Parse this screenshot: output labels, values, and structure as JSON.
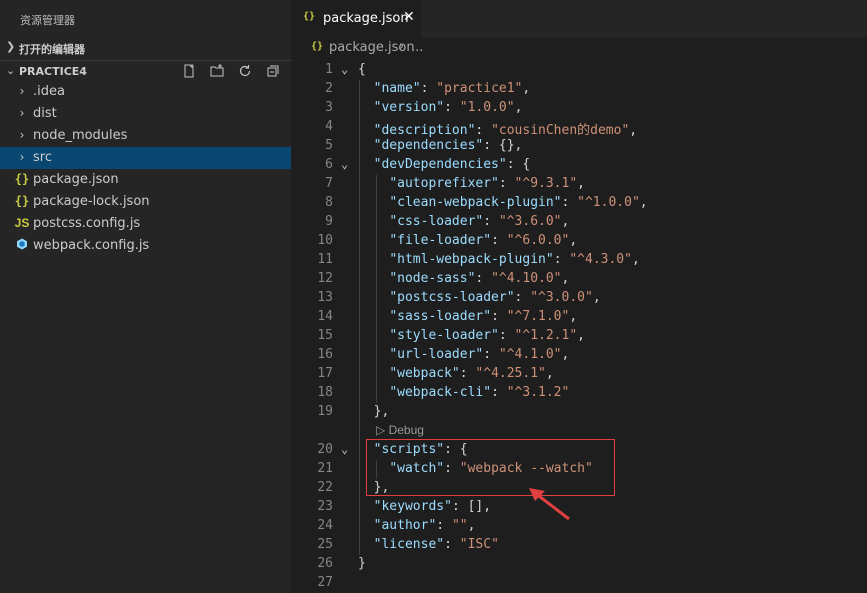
{
  "sidebar": {
    "title": "资源管理器",
    "open_editors_label": "打开的编辑器",
    "project_label": "PRACTICE4",
    "items": [
      {
        "label": ".idea",
        "icon": "chevron-right-icon"
      },
      {
        "label": "dist",
        "icon": "chevron-right-icon"
      },
      {
        "label": "node_modules",
        "icon": "chevron-right-icon"
      },
      {
        "label": "src",
        "icon": "chevron-right-icon"
      },
      {
        "label": "package.json",
        "icon": "json-file-icon"
      },
      {
        "label": "package-lock.json",
        "icon": "json-file-icon"
      },
      {
        "label": "postcss.config.js",
        "icon": "js-file-icon"
      },
      {
        "label": "webpack.config.js",
        "icon": "webpack-file-icon"
      }
    ]
  },
  "tab": {
    "label": "package.json",
    "close": "✕"
  },
  "breadcrumb": {
    "file": "package.json",
    "separator": "›",
    "more": "..."
  },
  "codelens": "▷ Debug",
  "lines": [
    {
      "n": "1",
      "fold": "⌄",
      "t": [
        [
          "p",
          "{"
        ]
      ]
    },
    {
      "n": "2",
      "t": [
        [
          "p",
          "  "
        ],
        [
          "k",
          "\"name\""
        ],
        [
          "p",
          ": "
        ],
        [
          "s",
          "\"practice1\""
        ],
        [
          "p",
          ","
        ]
      ]
    },
    {
      "n": "3",
      "t": [
        [
          "p",
          "  "
        ],
        [
          "k",
          "\"version\""
        ],
        [
          "p",
          ": "
        ],
        [
          "s",
          "\"1.0.0\""
        ],
        [
          "p",
          ","
        ]
      ]
    },
    {
      "n": "4",
      "t": [
        [
          "p",
          "  "
        ],
        [
          "k",
          "\"description\""
        ],
        [
          "p",
          ": "
        ],
        [
          "s",
          "\"cousinChen的demo\""
        ],
        [
          "p",
          ","
        ]
      ]
    },
    {
      "n": "5",
      "t": [
        [
          "p",
          "  "
        ],
        [
          "k",
          "\"dependencies\""
        ],
        [
          "p",
          ": {},"
        ]
      ]
    },
    {
      "n": "6",
      "fold": "⌄",
      "t": [
        [
          "p",
          "  "
        ],
        [
          "k",
          "\"devDependencies\""
        ],
        [
          "p",
          ": {"
        ]
      ]
    },
    {
      "n": "7",
      "t": [
        [
          "p",
          "    "
        ],
        [
          "k",
          "\"autoprefixer\""
        ],
        [
          "p",
          ": "
        ],
        [
          "s",
          "\"^9.3.1\""
        ],
        [
          "p",
          ","
        ]
      ]
    },
    {
      "n": "8",
      "t": [
        [
          "p",
          "    "
        ],
        [
          "k",
          "\"clean-webpack-plugin\""
        ],
        [
          "p",
          ": "
        ],
        [
          "s",
          "\"^1.0.0\""
        ],
        [
          "p",
          ","
        ]
      ]
    },
    {
      "n": "9",
      "t": [
        [
          "p",
          "    "
        ],
        [
          "k",
          "\"css-loader\""
        ],
        [
          "p",
          ": "
        ],
        [
          "s",
          "\"^3.6.0\""
        ],
        [
          "p",
          ","
        ]
      ]
    },
    {
      "n": "10",
      "t": [
        [
          "p",
          "    "
        ],
        [
          "k",
          "\"file-loader\""
        ],
        [
          "p",
          ": "
        ],
        [
          "s",
          "\"^6.0.0\""
        ],
        [
          "p",
          ","
        ]
      ]
    },
    {
      "n": "11",
      "t": [
        [
          "p",
          "    "
        ],
        [
          "k",
          "\"html-webpack-plugin\""
        ],
        [
          "p",
          ": "
        ],
        [
          "s",
          "\"^4.3.0\""
        ],
        [
          "p",
          ","
        ]
      ]
    },
    {
      "n": "12",
      "t": [
        [
          "p",
          "    "
        ],
        [
          "k",
          "\"node-sass\""
        ],
        [
          "p",
          ": "
        ],
        [
          "s",
          "\"^4.10.0\""
        ],
        [
          "p",
          ","
        ]
      ]
    },
    {
      "n": "13",
      "t": [
        [
          "p",
          "    "
        ],
        [
          "k",
          "\"postcss-loader\""
        ],
        [
          "p",
          ": "
        ],
        [
          "s",
          "\"^3.0.0\""
        ],
        [
          "p",
          ","
        ]
      ]
    },
    {
      "n": "14",
      "t": [
        [
          "p",
          "    "
        ],
        [
          "k",
          "\"sass-loader\""
        ],
        [
          "p",
          ": "
        ],
        [
          "s",
          "\"^7.1.0\""
        ],
        [
          "p",
          ","
        ]
      ]
    },
    {
      "n": "15",
      "t": [
        [
          "p",
          "    "
        ],
        [
          "k",
          "\"style-loader\""
        ],
        [
          "p",
          ": "
        ],
        [
          "s",
          "\"^1.2.1\""
        ],
        [
          "p",
          ","
        ]
      ]
    },
    {
      "n": "16",
      "t": [
        [
          "p",
          "    "
        ],
        [
          "k",
          "\"url-loader\""
        ],
        [
          "p",
          ": "
        ],
        [
          "s",
          "\"^4.1.0\""
        ],
        [
          "p",
          ","
        ]
      ]
    },
    {
      "n": "17",
      "t": [
        [
          "p",
          "    "
        ],
        [
          "k",
          "\"webpack\""
        ],
        [
          "p",
          ": "
        ],
        [
          "s",
          "\"^4.25.1\""
        ],
        [
          "p",
          ","
        ]
      ]
    },
    {
      "n": "18",
      "t": [
        [
          "p",
          "    "
        ],
        [
          "k",
          "\"webpack-cli\""
        ],
        [
          "p",
          ": "
        ],
        [
          "s",
          "\"^3.1.2\""
        ]
      ]
    },
    {
      "n": "19",
      "t": [
        [
          "p",
          "  },"
        ]
      ]
    },
    {
      "n": "20",
      "fold": "⌄",
      "t": [
        [
          "p",
          "  "
        ],
        [
          "k",
          "\"scripts\""
        ],
        [
          "p",
          ": {"
        ]
      ]
    },
    {
      "n": "21",
      "t": [
        [
          "p",
          "    "
        ],
        [
          "k",
          "\"watch\""
        ],
        [
          "p",
          ": "
        ],
        [
          "s",
          "\"webpack --watch\""
        ]
      ]
    },
    {
      "n": "22",
      "t": [
        [
          "p",
          "  },"
        ]
      ]
    },
    {
      "n": "23",
      "t": [
        [
          "p",
          "  "
        ],
        [
          "k",
          "\"keywords\""
        ],
        [
          "p",
          ": [],"
        ]
      ]
    },
    {
      "n": "24",
      "t": [
        [
          "p",
          "  "
        ],
        [
          "k",
          "\"author\""
        ],
        [
          "p",
          ": "
        ],
        [
          "s",
          "\"\""
        ],
        [
          "p",
          ","
        ]
      ]
    },
    {
      "n": "25",
      "t": [
        [
          "p",
          "  "
        ],
        [
          "k",
          "\"license\""
        ],
        [
          "p",
          ": "
        ],
        [
          "s",
          "\"ISC\""
        ]
      ]
    },
    {
      "n": "26",
      "t": [
        [
          "p",
          "}"
        ]
      ]
    },
    {
      "n": "27",
      "t": []
    }
  ],
  "colors": {
    "accent_selection": "#094771",
    "annotation": "#e04040"
  }
}
